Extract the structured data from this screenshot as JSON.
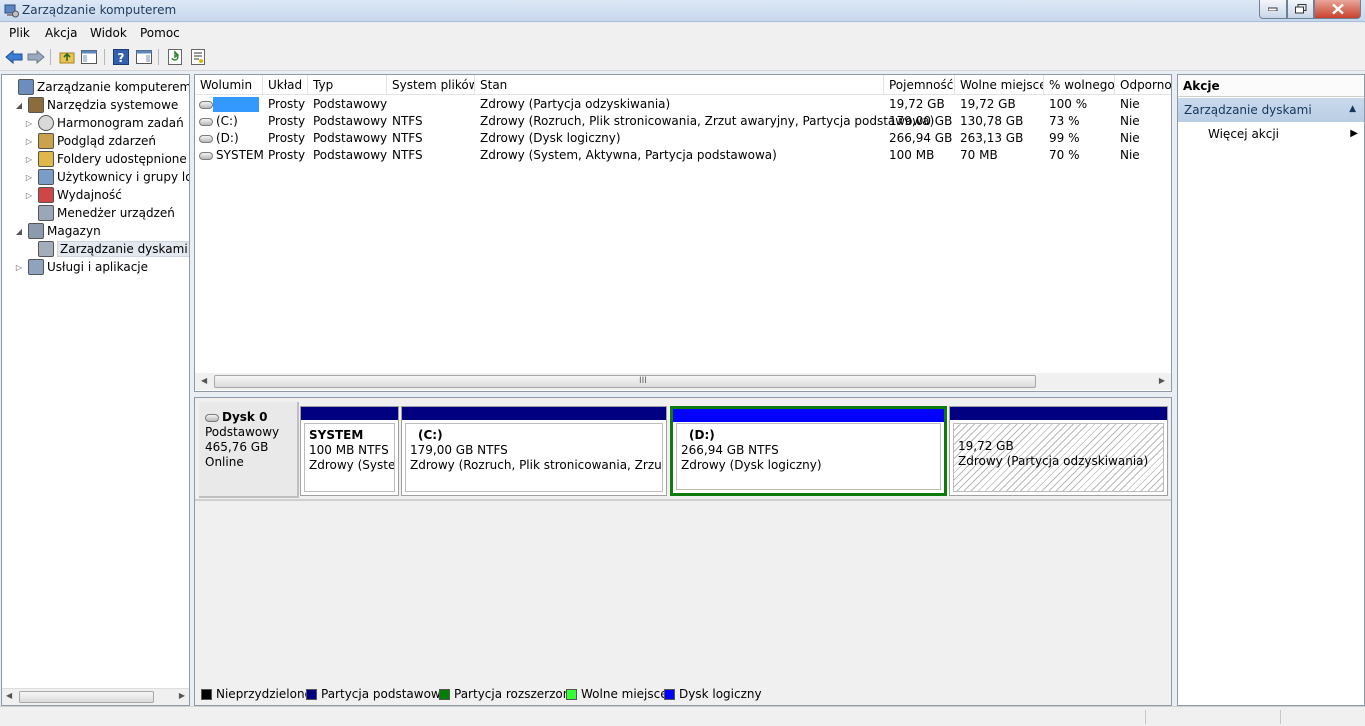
{
  "window": {
    "title": "Zarządzanie komputerem"
  },
  "menu": [
    "Plik",
    "Akcja",
    "Widok",
    "Pomoc"
  ],
  "toolbar": {
    "buttons": [
      "back-icon",
      "forward-icon",
      "folder-up-icon",
      "show-hide-tree-icon",
      "help-icon",
      "show-hide-action-pane-icon",
      "refresh-icon",
      "properties-icon"
    ]
  },
  "tree": {
    "items": [
      {
        "label": "Zarządzanie komputerem (lokalne)",
        "icon": "computer-icon",
        "level": 0,
        "expander": ""
      },
      {
        "label": "Narzędzia systemowe",
        "icon": "tools-icon",
        "level": 1,
        "expander": "◢"
      },
      {
        "label": "Harmonogram zadań",
        "icon": "clock-icon",
        "level": 2,
        "expander": "▷"
      },
      {
        "label": "Podgląd zdarzeń",
        "icon": "event-viewer-icon",
        "level": 2,
        "expander": "▷"
      },
      {
        "label": "Foldery udostępnione",
        "icon": "shared-folder-icon",
        "level": 2,
        "expander": "▷"
      },
      {
        "label": "Użytkownicy i grupy lokalne",
        "icon": "users-icon",
        "level": 2,
        "expander": "▷"
      },
      {
        "label": "Wydajność",
        "icon": "performance-icon",
        "level": 2,
        "expander": "▷"
      },
      {
        "label": "Menedżer urządzeń",
        "icon": "device-manager-icon",
        "level": 2,
        "expander": ""
      },
      {
        "label": "Magazyn",
        "icon": "storage-icon",
        "level": 1,
        "expander": "◢"
      },
      {
        "label": "Zarządzanie dyskami",
        "icon": "disk-management-icon",
        "level": 2,
        "expander": "",
        "selected": true
      },
      {
        "label": "Usługi i aplikacje",
        "icon": "services-icon",
        "level": 1,
        "expander": "▷"
      }
    ]
  },
  "volumes": {
    "columns": [
      "Wolumin",
      "Układ",
      "Typ",
      "System plików",
      "Stan",
      "Pojemność",
      "Wolne miejsce",
      "% wolnego",
      "Odporność"
    ],
    "rows": [
      {
        "name": "",
        "layout": "Prosty",
        "type": "Podstawowy",
        "fs": "",
        "status": "Zdrowy (Partycja odzyskiwania)",
        "capacity": "19,72 GB",
        "free": "19,72 GB",
        "pct": "100 %",
        "fault": "Nie",
        "highlight": true
      },
      {
        "name": "(C:)",
        "layout": "Prosty",
        "type": "Podstawowy",
        "fs": "NTFS",
        "status": "Zdrowy (Rozruch, Plik stronicowania, Zrzut awaryjny, Partycja podstawowa)",
        "capacity": "179,00 GB",
        "free": "130,78 GB",
        "pct": "73 %",
        "fault": "Nie"
      },
      {
        "name": "(D:)",
        "layout": "Prosty",
        "type": "Podstawowy",
        "fs": "NTFS",
        "status": "Zdrowy (Dysk logiczny)",
        "capacity": "266,94 GB",
        "free": "263,13 GB",
        "pct": "99 %",
        "fault": "Nie"
      },
      {
        "name": "SYSTEM",
        "layout": "Prosty",
        "type": "Podstawowy",
        "fs": "NTFS",
        "status": "Zdrowy (System, Aktywna, Partycja podstawowa)",
        "capacity": "100 MB",
        "free": "70 MB",
        "pct": "70 %",
        "fault": "Nie"
      }
    ],
    "scroll_grip": "III"
  },
  "disk": {
    "name": "Dysk 0",
    "type": "Podstawowy",
    "size": "465,76 GB",
    "state": "Online",
    "partitions": [
      {
        "title": "SYSTEM",
        "size": "100 MB NTFS",
        "status": "Zdrowy (System, Aktywna, Partycja podstawowa)"
      },
      {
        "title": "(C:)",
        "size": "179,00 GB NTFS",
        "status": "Zdrowy (Rozruch, Plik stronicowania, Zrzut awaryjny, Partycja podstawowa)"
      },
      {
        "title": "(D:)",
        "size": "266,94 GB NTFS",
        "status": "Zdrowy (Dysk logiczny)"
      },
      {
        "title": "",
        "size": "19,72 GB",
        "status": "Zdrowy (Partycja odzyskiwania)"
      }
    ]
  },
  "legend": [
    {
      "label": "Nieprzydzielone",
      "color": "#000000"
    },
    {
      "label": "Partycja podstawowa",
      "color": "#000080"
    },
    {
      "label": "Partycja rozszerzona",
      "color": "#008000"
    },
    {
      "label": "Wolne miejsce",
      "color": "#33ff33"
    },
    {
      "label": "Dysk logiczny",
      "color": "#0000ff"
    }
  ],
  "actions": {
    "title": "Akcje",
    "section": "Zarządzanie dyskami",
    "item": "Więcej akcji"
  }
}
